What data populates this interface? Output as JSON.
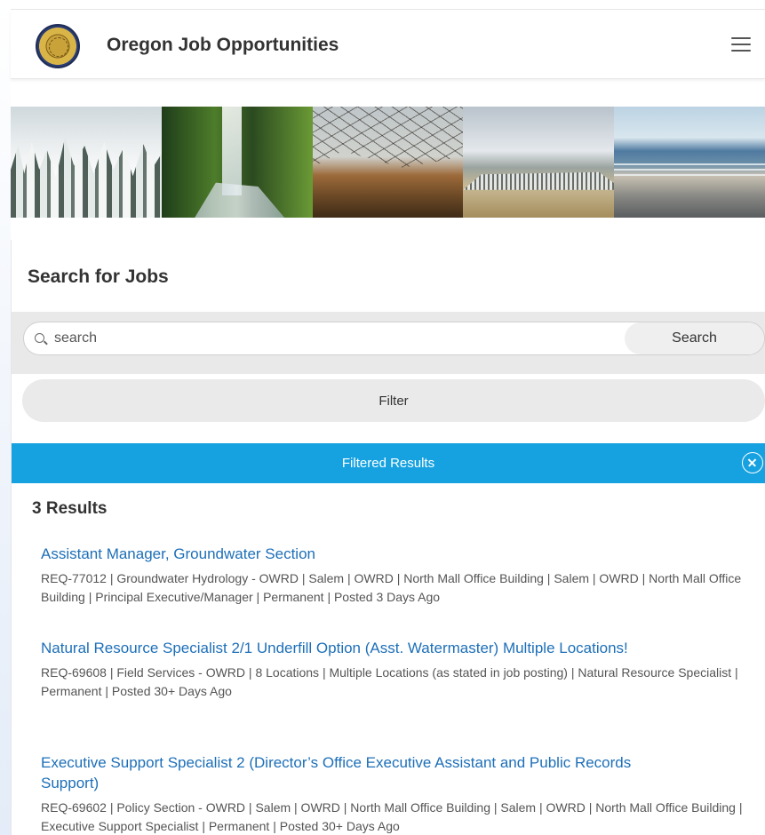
{
  "header": {
    "title": "Oregon Job Opportunities",
    "logo_icon": "oregon-state-seal-icon",
    "menu_icon": "hamburger-menu-icon"
  },
  "banner": {
    "images": [
      "snowy-forest",
      "waterfall",
      "oak-savanna",
      "high-desert-butte",
      "coastal-beach"
    ]
  },
  "search": {
    "title": "Search for Jobs",
    "placeholder": "search",
    "value": "",
    "button_label": "Search",
    "icon": "search-icon"
  },
  "filter": {
    "button_label": "Filter"
  },
  "filtered_results": {
    "label": "Filtered Results",
    "clear_icon": "close-circle-icon",
    "color": "#16a2e0"
  },
  "results": {
    "count_label": "3 Results",
    "jobs": [
      {
        "title": "Assistant Manager, Groundwater Section",
        "meta": "REQ-77012  |  Groundwater Hydrology - OWRD  |  Salem | OWRD | North Mall Office Building  |  Salem | OWRD | North Mall Office Building  |  Principal Executive/Manager  |  Permanent  |  Posted 3 Days Ago"
      },
      {
        "title": "Natural Resource Specialist 2/1 Underfill Option (Asst. Watermaster) Multiple Locations!",
        "meta": "REQ-69608  |  Field Services - OWRD  |  8 Locations  |  Multiple Locations (as stated in job posting)  |  Natural Resource Specialist  |  Permanent  |  Posted 30+ Days Ago"
      },
      {
        "title": "Executive Support Specialist 2 (Director’s Office Executive Assistant and Public Records Support)",
        "meta": "REQ-69602  |  Policy Section - OWRD  |  Salem | OWRD | North Mall Office Building  |  Salem | OWRD | North Mall Office Building  |  Executive Support Specialist  |  Permanent  |  Posted 30+ Days Ago"
      }
    ]
  },
  "colors": {
    "link": "#1d6fb8",
    "accent": "#16a2e0"
  }
}
